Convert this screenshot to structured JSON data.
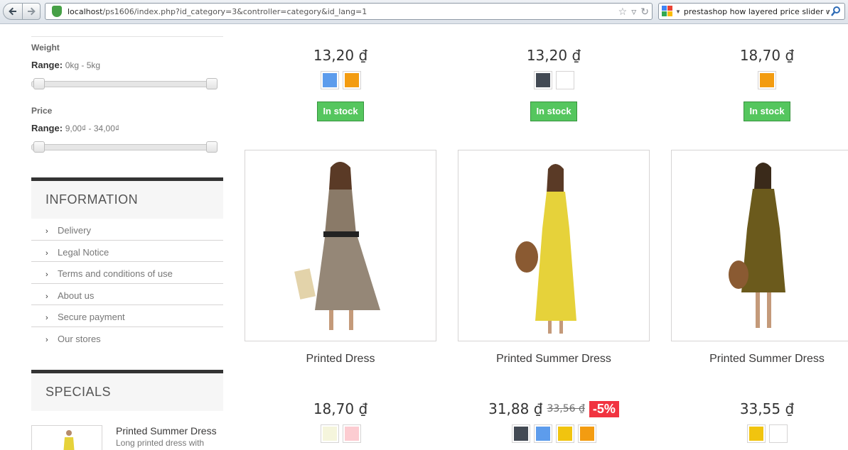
{
  "browser": {
    "url_host": "localhost",
    "url_path": "/ps1606/index.php?id_category=3&controller=category&id_lang=1",
    "search_query": "prestashop how layered price slider work"
  },
  "filters": {
    "weight": {
      "title": "Weight",
      "range_label": "Range:",
      "range_value": "0kg - 5kg",
      "low": 0,
      "high": 1
    },
    "price": {
      "title": "Price",
      "range_label": "Range:",
      "range_value": "9,00₫ - 34,00₫",
      "low": 0,
      "high": 1
    }
  },
  "information": {
    "title": "INFORMATION",
    "items": [
      "Delivery",
      "Legal Notice",
      "Terms and conditions of use",
      "About us",
      "Secure payment",
      "Our stores"
    ]
  },
  "specials": {
    "title": "SPECIALS",
    "item_name": "Printed Summer Dress",
    "item_desc": "Long printed dress with"
  },
  "products_top": [
    {
      "price": "13,20 ₫",
      "colors": [
        "#5d9cec",
        "#f39c11"
      ],
      "stock": "In stock"
    },
    {
      "price": "13,20 ₫",
      "colors": [
        "#434a54",
        "#ffffff"
      ],
      "stock": "In stock"
    },
    {
      "price": "18,70 ₫",
      "colors": [
        "#f39c11"
      ],
      "stock": "In stock"
    }
  ],
  "products": [
    {
      "name": "Printed Dress",
      "price": "18,70 ₫",
      "old_price": "",
      "discount": "",
      "colors": [
        "#f5f5dc",
        "#fcccd1"
      ],
      "dress": "#8a7a68"
    },
    {
      "name": "Printed Summer Dress",
      "price": "31,88 ₫",
      "old_price": "33,56 ₫",
      "discount": "-5%",
      "colors": [
        "#434a54",
        "#5d9cec",
        "#f1c40f",
        "#f39c11"
      ],
      "dress": "#e6d23a"
    },
    {
      "name": "Printed Summer Dress",
      "price": "33,55 ₫",
      "old_price": "",
      "discount": "",
      "colors": [
        "#f1c40f",
        "#ffffff"
      ],
      "dress": "#6b5a1c"
    }
  ]
}
